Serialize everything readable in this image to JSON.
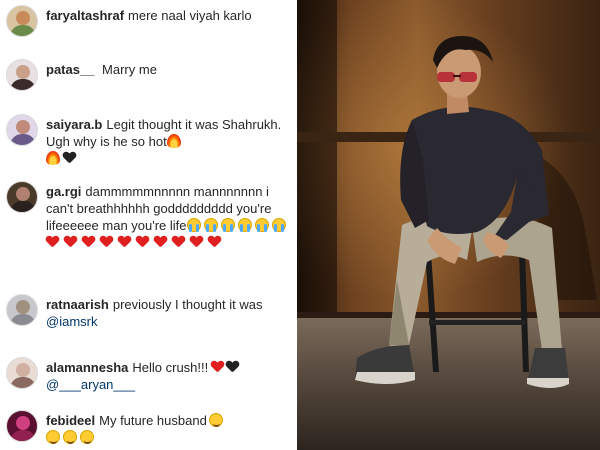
{
  "comments": [
    {
      "username": "faryaltashraf",
      "text": "mere naal viyah karlo",
      "avatar_color": "#c98a5a"
    },
    {
      "username": "patas__",
      "text": " Marry me",
      "avatar_color": "#3a2a2a"
    },
    {
      "username": "saiyara.b",
      "text": "Legit thought it was Shahrukh. Ugh why is he so hot",
      "trailing_emoji": [
        "fire",
        "fire",
        "black-heart"
      ],
      "avatar_color": "#c08a7a"
    },
    {
      "username": "ga.rgi",
      "text": "dammmmmnnnnn mannnnnnn i can't breathhhhhh goddddddddd you're lifeeeeee man you're life",
      "trailing_emoji": [
        "crying",
        "crying",
        "crying",
        "crying",
        "crying",
        "crying"
      ],
      "second_row_emoji": [
        "red-heart",
        "red-heart",
        "red-heart",
        "red-heart",
        "red-heart",
        "red-heart",
        "red-heart",
        "red-heart",
        "red-heart",
        "red-heart"
      ],
      "avatar_color": "#5a4a3a"
    },
    {
      "username": "ratnaarish",
      "text": "previously I thought it was ",
      "mention": "@iamsrk",
      "avatar_color": "#8a8a90"
    },
    {
      "username": "alamannesha",
      "text": "Hello crush!!!",
      "trailing_emoji": [
        "red-heart",
        "black-heart"
      ],
      "mention": "@___aryan___",
      "avatar_color": "#d0b0a0"
    },
    {
      "username": "febideel",
      "text": "My future husband",
      "trailing_emoji": [
        "smiling",
        "smiling",
        "smiling",
        "smiling"
      ],
      "avatar_color": "#b0306a"
    }
  ]
}
